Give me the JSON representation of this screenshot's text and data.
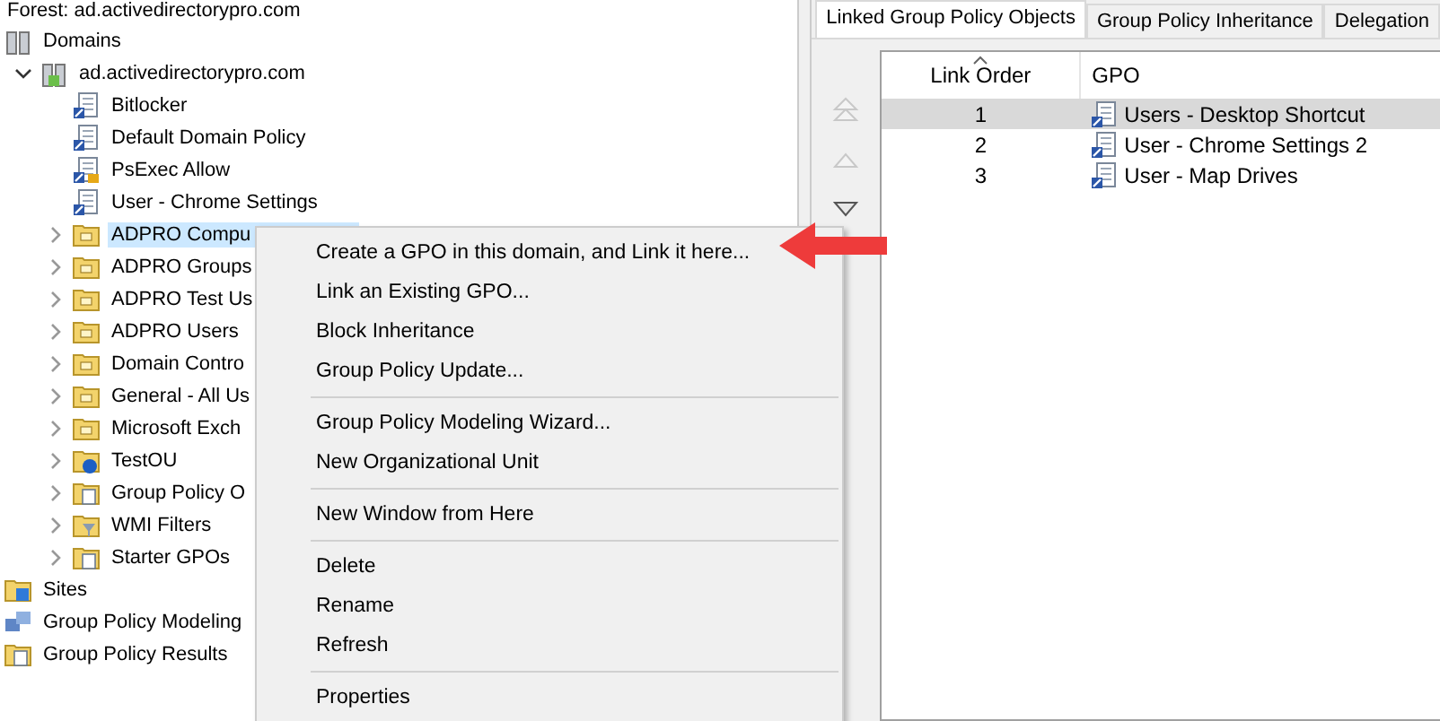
{
  "tree": {
    "forest": "Forest: ad.activedirectorypro.com",
    "nodes": [
      {
        "label": "Domains",
        "kind": "domains",
        "children": [
          {
            "label": "ad.activedirectorypro.com",
            "kind": "domain",
            "expanded": true,
            "selected": false,
            "children": [
              {
                "label": "Bitlocker",
                "kind": "gpo-link",
                "selected": false
              },
              {
                "label": "Default Domain Policy",
                "kind": "gpo-link",
                "selected": false
              },
              {
                "label": "PsExec Allow",
                "kind": "gpo-locked",
                "selected": false
              },
              {
                "label": "User - Chrome Settings",
                "kind": "gpo-link",
                "selected": false
              },
              {
                "label": "ADPRO Compu",
                "kind": "ou",
                "expanded": false,
                "selected": true
              },
              {
                "label": "ADPRO Groups",
                "kind": "ou",
                "expanded": false,
                "selected": false
              },
              {
                "label": "ADPRO Test Us",
                "kind": "ou",
                "expanded": false,
                "selected": false
              },
              {
                "label": "ADPRO Users",
                "kind": "ou",
                "expanded": false,
                "selected": false
              },
              {
                "label": "Domain Contro",
                "kind": "ou",
                "expanded": false,
                "selected": false
              },
              {
                "label": "General - All Us",
                "kind": "ou",
                "expanded": false,
                "selected": false
              },
              {
                "label": "Microsoft Exch",
                "kind": "ou",
                "expanded": false,
                "selected": false
              },
              {
                "label": "TestOU",
                "kind": "ou-info",
                "expanded": false,
                "selected": false
              },
              {
                "label": "Group Policy O",
                "kind": "gpo-folder",
                "expanded": false,
                "selected": false
              },
              {
                "label": "WMI Filters",
                "kind": "wmi",
                "expanded": false,
                "selected": false
              },
              {
                "label": "Starter GPOs",
                "kind": "starter",
                "expanded": false,
                "selected": false
              }
            ]
          }
        ]
      },
      {
        "label": "Sites",
        "kind": "sites"
      },
      {
        "label": "Group Policy Modeling",
        "kind": "modeling"
      },
      {
        "label": "Group Policy Results",
        "kind": "results"
      }
    ]
  },
  "tabs": [
    {
      "label": "Linked Group Policy Objects",
      "selected": true
    },
    {
      "label": "Group Policy Inheritance",
      "selected": false
    },
    {
      "label": "Delegation",
      "selected": false
    }
  ],
  "order_buttons": [
    {
      "kind": "top",
      "disabled": true
    },
    {
      "kind": "up",
      "disabled": true
    },
    {
      "kind": "down",
      "disabled": false
    }
  ],
  "table": {
    "columns": [
      "Link Order",
      "GPO"
    ],
    "rows": [
      {
        "order": "1",
        "gpo": "Users - Desktop Shortcut",
        "selected": true
      },
      {
        "order": "2",
        "gpo": "User - Chrome Settings 2",
        "selected": false
      },
      {
        "order": "3",
        "gpo": "User - Map Drives",
        "selected": false
      }
    ]
  },
  "context_menu": [
    [
      "Create a GPO in this domain, and Link it here...",
      "Link an Existing GPO...",
      "Block Inheritance",
      "Group Policy Update..."
    ],
    [
      "Group Policy Modeling Wizard...",
      "New Organizational Unit"
    ],
    [
      "New Window from Here"
    ],
    [
      "Delete",
      "Rename",
      "Refresh"
    ],
    [
      "Properties"
    ]
  ]
}
